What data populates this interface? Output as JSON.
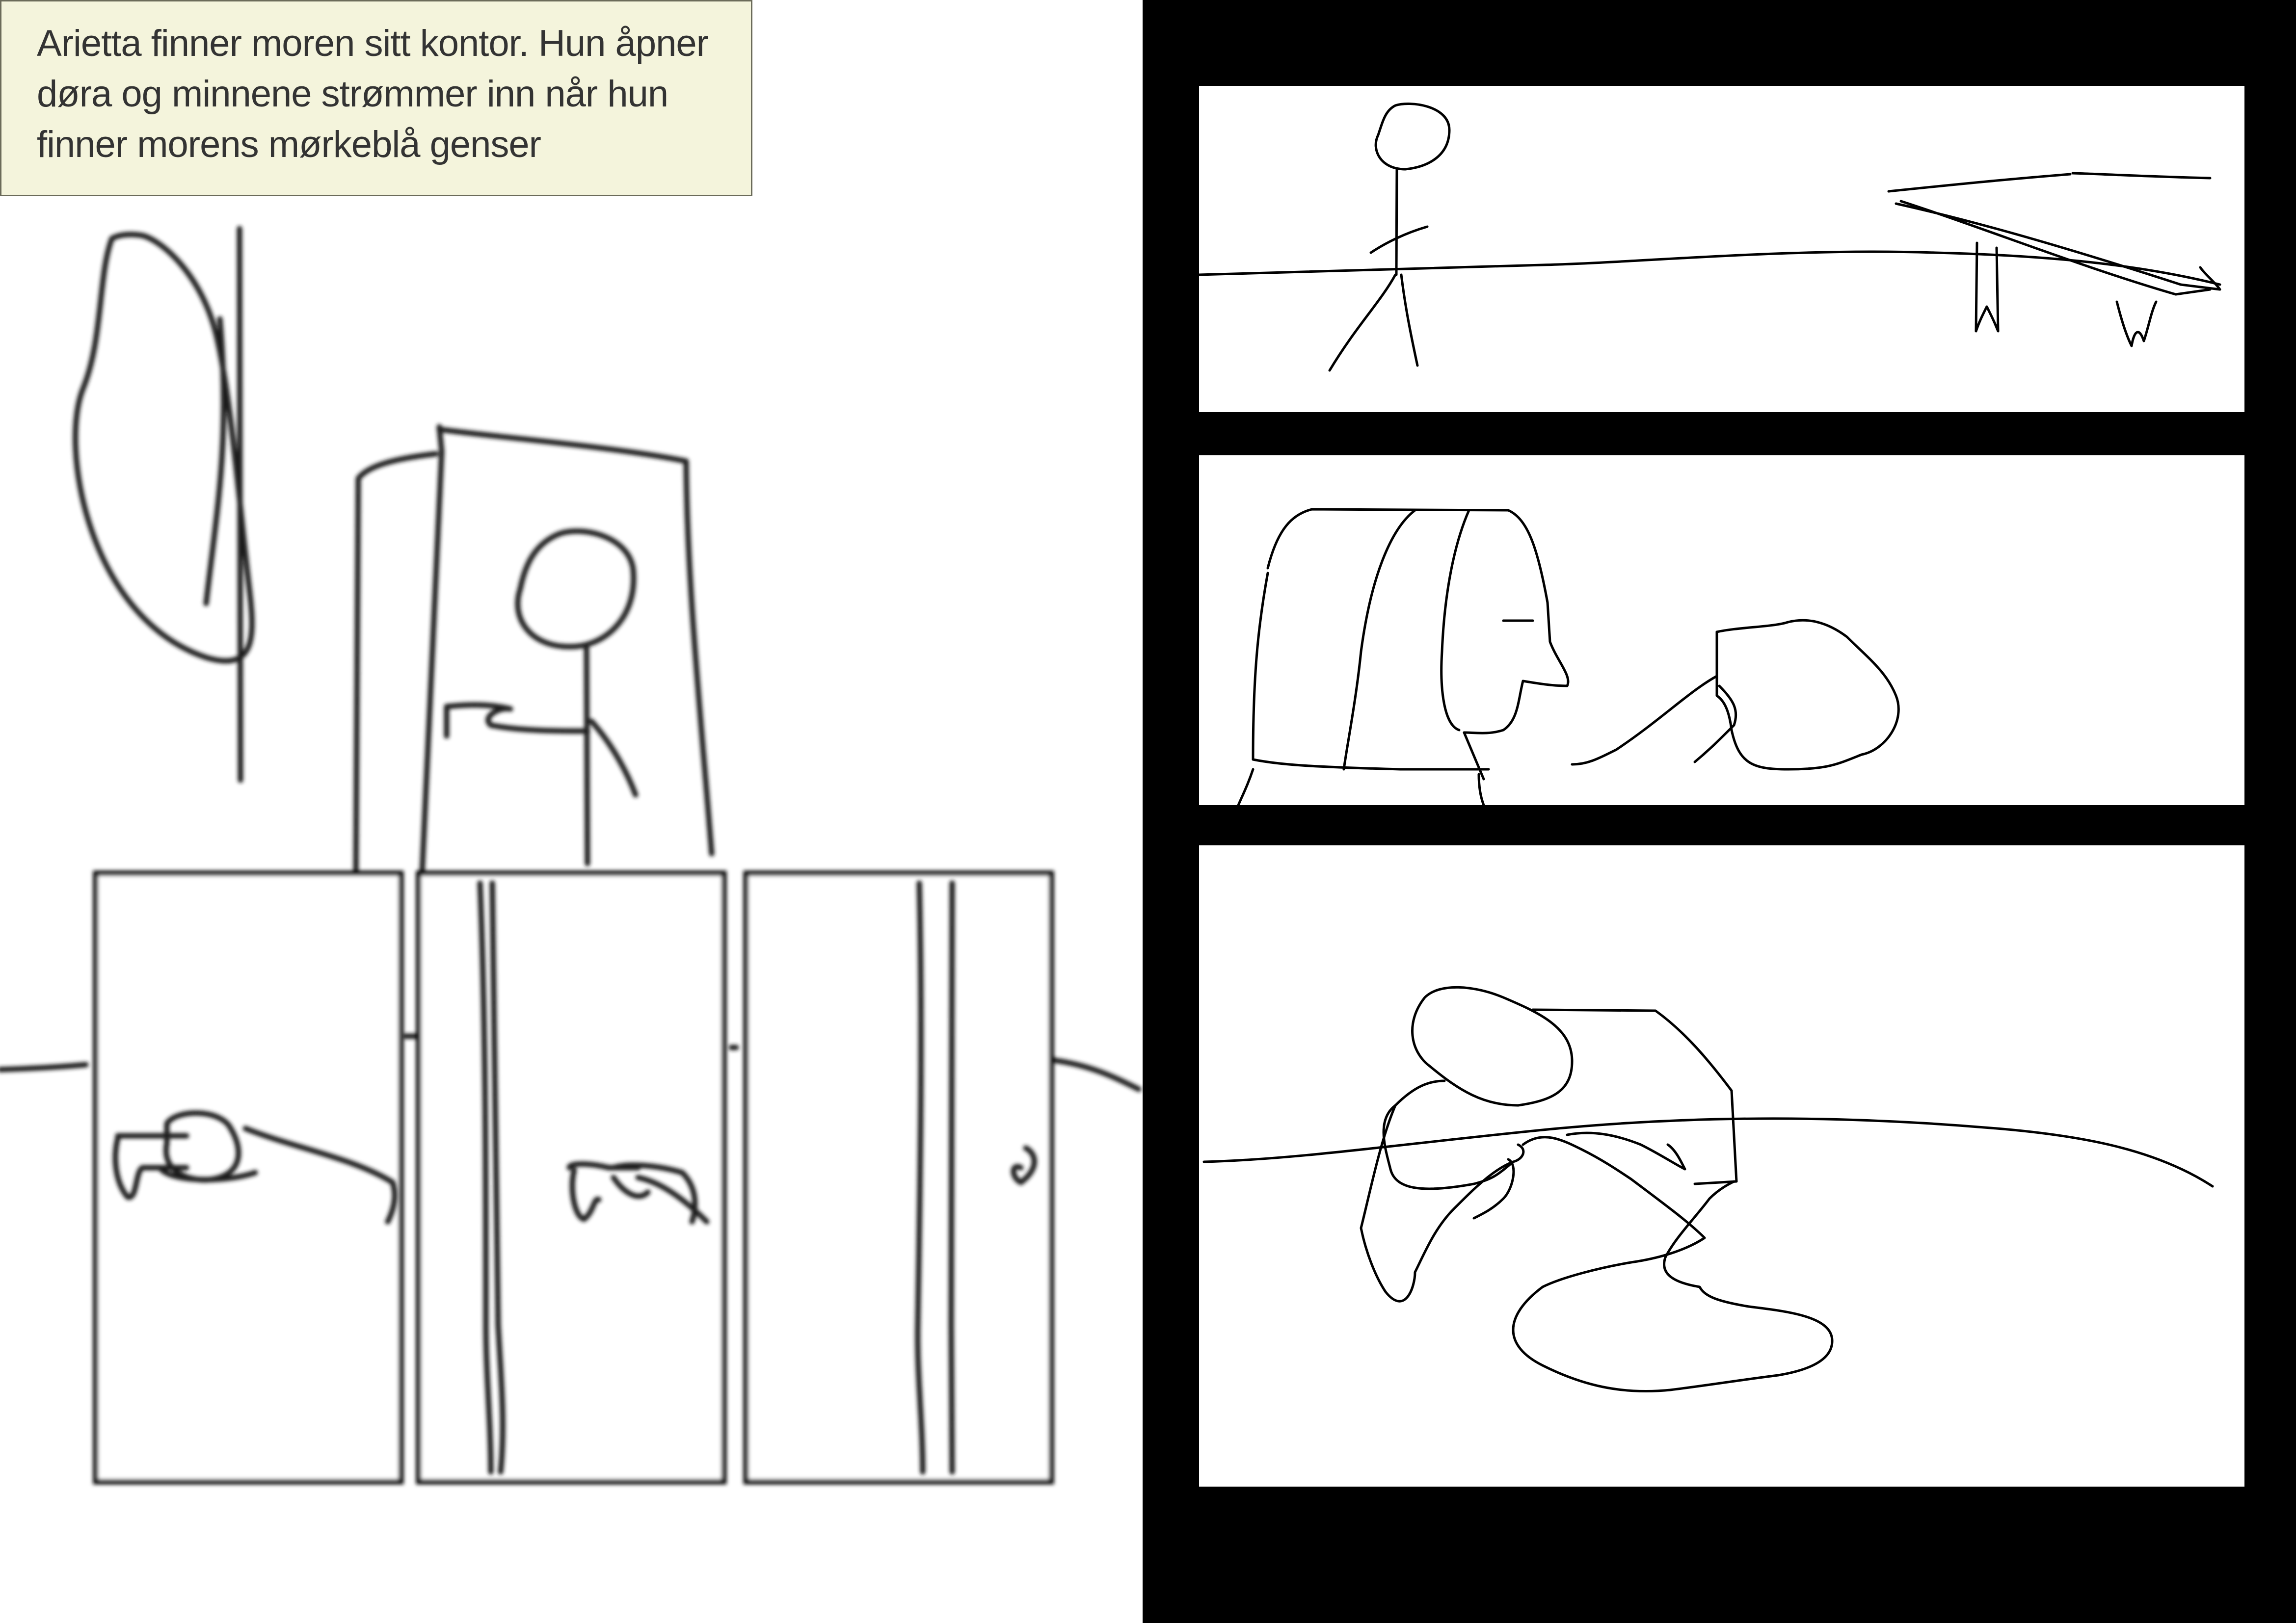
{
  "caption": {
    "lines": [
      "Arietta finner moren sitt kontor. Hun åpner",
      "døra  og minnene strømmer inn når hun",
      "finner morens mørkeblå genser"
    ]
  },
  "colors": {
    "caption_background": "#f4f4dc",
    "caption_text": "#333333",
    "strip_background": "#000000",
    "panel_background": "#ffffff",
    "line_color": "#000000"
  },
  "sketch_panels_left": {
    "count": 3
  },
  "sketch_panels_right": {
    "count": 3
  }
}
